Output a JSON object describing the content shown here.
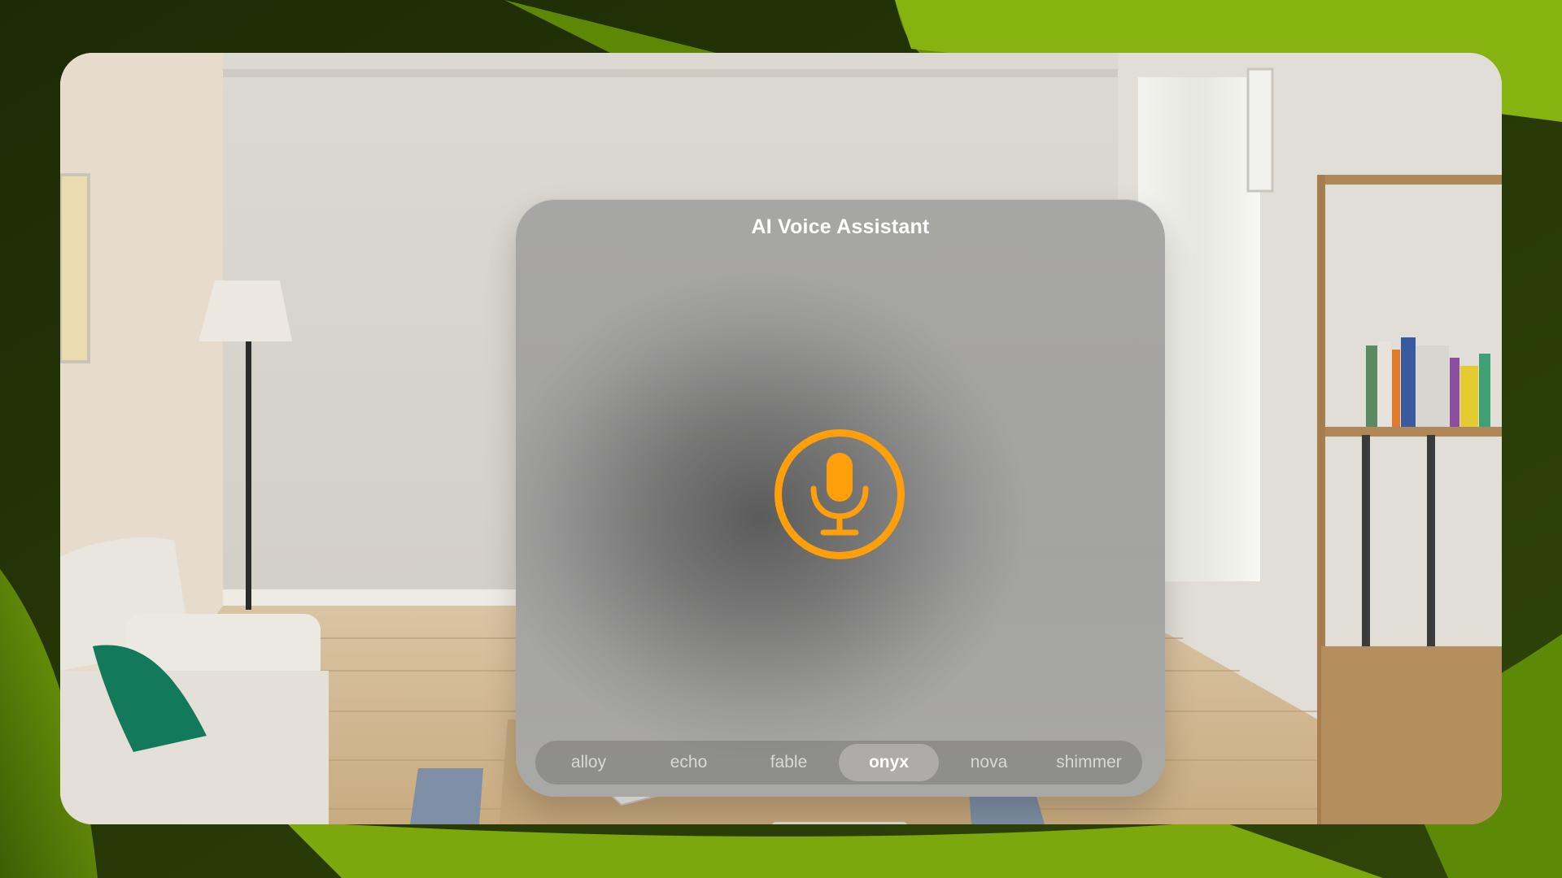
{
  "window": {
    "title": "AI Voice Assistant"
  },
  "mic_button": {
    "icon": "microphone-icon",
    "color": "#ff9f0a"
  },
  "voice_picker": {
    "options": [
      {
        "label": "alloy",
        "selected": false
      },
      {
        "label": "echo",
        "selected": false
      },
      {
        "label": "fable",
        "selected": false
      },
      {
        "label": "onyx",
        "selected": true
      },
      {
        "label": "nova",
        "selected": false
      },
      {
        "label": "shimmer",
        "selected": false
      }
    ]
  },
  "colors": {
    "accent": "#ff9f0a",
    "wallpaper_green": "#6f9a0a"
  }
}
